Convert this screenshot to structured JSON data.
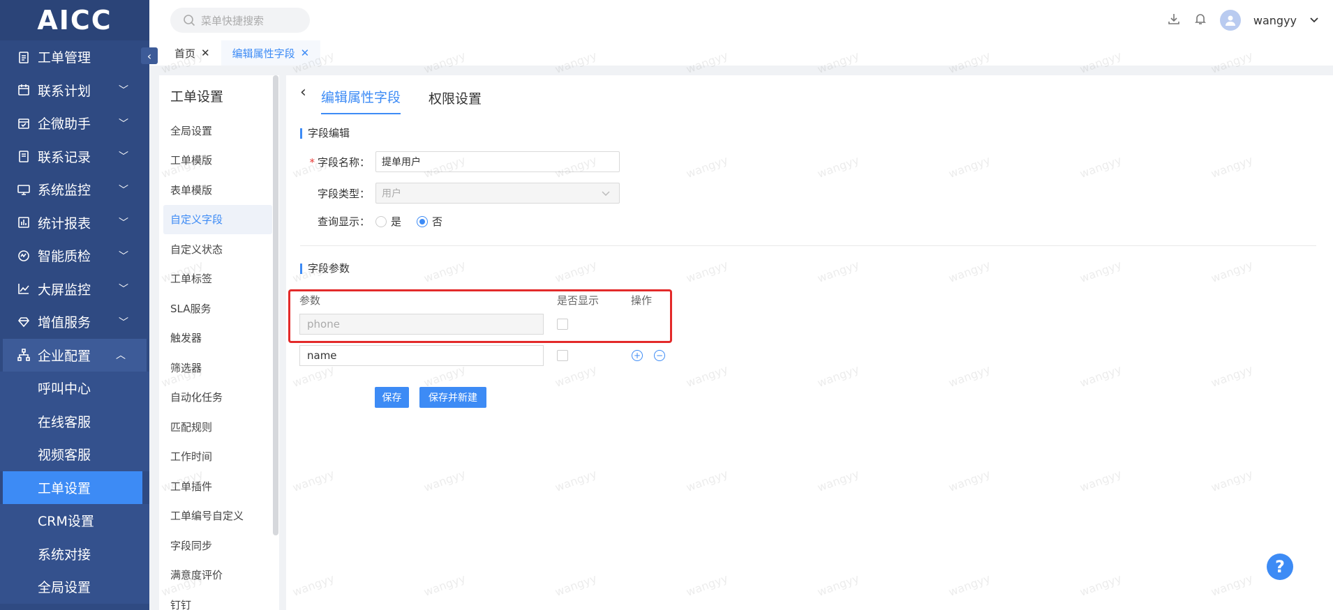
{
  "app": {
    "logo": "AICC"
  },
  "sidebar": {
    "items": [
      {
        "label": "工单管理",
        "icon": "clipboard-icon",
        "has_chevron": false
      },
      {
        "label": "联系计划",
        "icon": "calendar-icon",
        "has_chevron": true
      },
      {
        "label": "企微助手",
        "icon": "calendar-check-icon",
        "has_chevron": true
      },
      {
        "label": "联系记录",
        "icon": "record-icon",
        "has_chevron": true
      },
      {
        "label": "系统监控",
        "icon": "monitor-icon",
        "has_chevron": true
      },
      {
        "label": "统计报表",
        "icon": "bar-chart-icon",
        "has_chevron": true
      },
      {
        "label": "智能质检",
        "icon": "gauge-icon",
        "has_chevron": true
      },
      {
        "label": "大屏监控",
        "icon": "trend-icon",
        "has_chevron": true
      },
      {
        "label": "增值服务",
        "icon": "diamond-icon",
        "has_chevron": true
      },
      {
        "label": "企业配置",
        "icon": "org-icon",
        "has_chevron": true,
        "expanded": true
      }
    ],
    "sub_items": [
      "呼叫中心",
      "在线客服",
      "视频客服",
      "工单设置",
      "CRM设置",
      "系统对接",
      "全局设置"
    ],
    "active_sub": "工单设置"
  },
  "header": {
    "search_placeholder": "菜单快捷搜索",
    "username": "wangyy"
  },
  "tabs": [
    {
      "label": "首页"
    },
    {
      "label": "编辑属性字段",
      "active": true
    }
  ],
  "subnav": {
    "title": "工单设置",
    "items": [
      "全局设置",
      "工单模版",
      "表单模版",
      "自定义字段",
      "自定义状态",
      "工单标签",
      "SLA服务",
      "触发器",
      "筛选器",
      "自动化任务",
      "匹配规则",
      "工作时间",
      "工单插件",
      "工单编号自定义",
      "字段同步",
      "满意度评价",
      "钉钉"
    ],
    "active": "自定义字段"
  },
  "main": {
    "tabs": [
      "编辑属性字段",
      "权限设置"
    ],
    "section1_title": "字段编辑",
    "field_name_label": "字段名称：",
    "field_name_value": "提单用户",
    "field_type_label": "字段类型：",
    "field_type_value": "用户",
    "query_display_label": "查询显示：",
    "radio_yes": "是",
    "radio_no": "否",
    "radio_selected": "否",
    "section2_title": "字段参数",
    "table_headers": {
      "param": "参数",
      "display": "是否显示",
      "action": "操作"
    },
    "params": [
      {
        "value": "phone",
        "disabled": true
      },
      {
        "value": "name",
        "disabled": false
      }
    ],
    "save_label": "保存",
    "save_new_label": "保存并新建"
  },
  "watermark": "wangyy",
  "colors": {
    "sidebar": "#2f4a82",
    "accent": "#3d8bf5",
    "highlight": "#e32a2a"
  }
}
